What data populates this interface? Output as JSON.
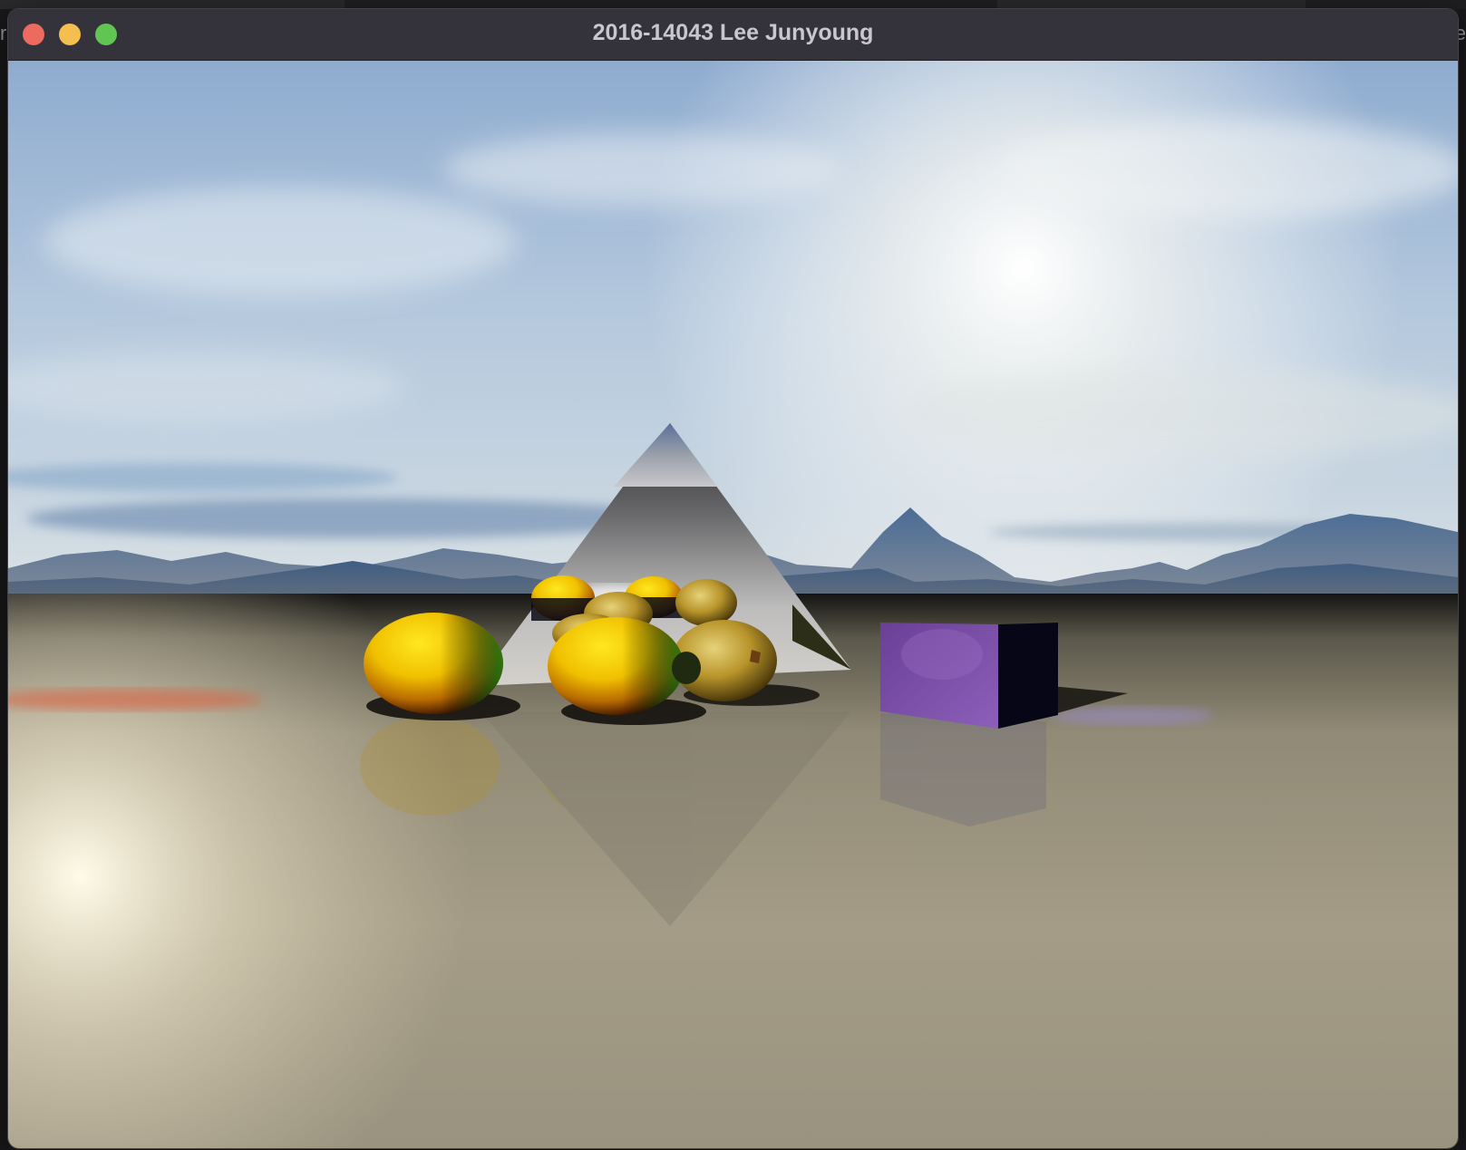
{
  "window": {
    "title": "2016-14043 Lee Junyoung",
    "controls": {
      "close_color": "#ed6a5e",
      "minimize_color": "#f5bf4f",
      "maximize_color": "#61c554"
    }
  },
  "background_edge_text": {
    "left": "r",
    "right": "e"
  },
  "scene": {
    "description_objects": [
      "sky",
      "mountains",
      "reflective-floor",
      "mirror-pyramid",
      "yellow-spheres",
      "gold-spheres",
      "purple-cube"
    ],
    "colors": {
      "sky_top": "#8fb0d4",
      "sky_horizon": "#e8eef2",
      "floor_near": "#a8a08a",
      "cube": "#7a4fa8",
      "gold": "#c9a53a"
    }
  }
}
